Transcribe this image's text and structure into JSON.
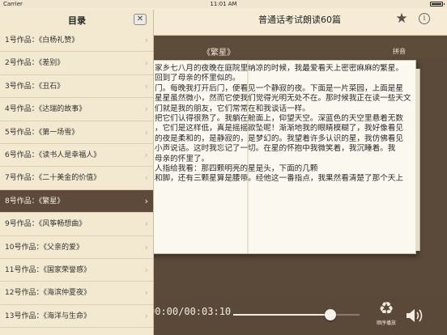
{
  "status_bar": {
    "carrier": "Carrier",
    "time": "11:01 AM"
  },
  "nav": {
    "title": "普通话考试朗读60篇",
    "favorite_icon": "star-icon",
    "info_icon": "info-icon"
  },
  "reader": {
    "book_title": "《繁星》",
    "pinyin_label": "拼音",
    "lines": [
      "家乡七八月的夜晚在庭院里纳凉的时候，我最爱看天上密密麻麻的繁星。",
      "回到了母亲的怀里似的。",
      "门。每晚我打开后门，便看见一个静寂的夜。下面是一片菜园，上面是星",
      "星星虽然微小，然而它使我们觉得光明无处不在。那时候我正在读一些天文",
      "们就是我的朋友，它们常常在和我谈话一样。",
      "把它们认得很熟了。我躺在舱面上，仰望天空。深蓝色的天空里悬着无数",
      "，它们是这样低，真是摇摇欲坠呢！渐渐地我的眼睛模糊了，我好像看见",
      "的夜是柔和的，是静寂的，是梦幻的。我望着许多认识的星，我仿佛看见",
      "小声说话。这时我忘记了一切。在星的怀抱中我微笑着，我沉睡着。我",
      "母亲的怀里了。",
      "人指给我看：那四颗明亮的星是头，下面的几颗",
      "和脚，还有三颗星算是腰带。经他这一番指点，我果然看清楚了那个天上"
    ],
    "line_gap_marker": 9
  },
  "player": {
    "time_text": "00:00/00:03:10",
    "progress": 0.77,
    "repeat_label": "顺序播放",
    "repeat_icon": "recycle-icon",
    "volume_icon": "speaker-icon"
  },
  "toc": {
    "title": "目录",
    "close_label": "✕",
    "items": [
      {
        "label": "1号作品：《白杨礼赞》",
        "active": false
      },
      {
        "label": "2号作品：《差别》",
        "active": false
      },
      {
        "label": "3号作品：《丑石》",
        "active": false
      },
      {
        "label": "4号作品：《达瑞的故事》",
        "active": false
      },
      {
        "label": "5号作品：《第一场雪》",
        "active": false
      },
      {
        "label": "6号作品：《读书人是幸福人》",
        "active": false
      },
      {
        "label": "7号作品：《二十美金的价值》",
        "active": false
      },
      {
        "label": "8号作品：《繁星》",
        "active": true
      },
      {
        "label": "9号作品：《风筝畅想曲》",
        "active": false
      },
      {
        "label": "10号作品：《父亲的爱》",
        "active": false
      },
      {
        "label": "11号作品：《国家荣誉感》",
        "active": false
      },
      {
        "label": "12号作品：《海滨仲夏夜》",
        "active": false
      },
      {
        "label": "13号作品：《海洋与生命》",
        "active": false
      }
    ]
  }
}
